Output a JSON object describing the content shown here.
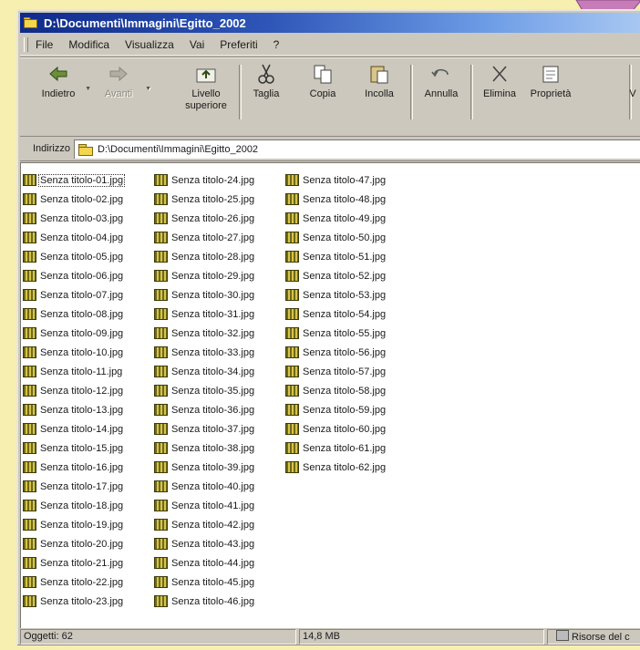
{
  "window": {
    "title": "D:\\Documenti\\Immagini\\Egitto_2002"
  },
  "menu": [
    "File",
    "Modifica",
    "Visualizza",
    "Vai",
    "Preferiti",
    "?"
  ],
  "toolbar": {
    "back": "Indietro",
    "forward": "Avanti",
    "up": "Livello superiore",
    "cut": "Taglia",
    "copy": "Copia",
    "paste": "Incolla",
    "undo": "Annulla",
    "delete": "Elimina",
    "properties": "Proprietà",
    "views_partial": "V"
  },
  "address": {
    "label": "Indirizzo",
    "path": "D:\\Documenti\\Immagini\\Egitto_2002"
  },
  "files": {
    "col1": [
      "Senza titolo-01.jpg",
      "Senza titolo-02.jpg",
      "Senza titolo-03.jpg",
      "Senza titolo-04.jpg",
      "Senza titolo-05.jpg",
      "Senza titolo-06.jpg",
      "Senza titolo-07.jpg",
      "Senza titolo-08.jpg",
      "Senza titolo-09.jpg",
      "Senza titolo-10.jpg",
      "Senza titolo-11.jpg",
      "Senza titolo-12.jpg",
      "Senza titolo-13.jpg",
      "Senza titolo-14.jpg",
      "Senza titolo-15.jpg",
      "Senza titolo-16.jpg",
      "Senza titolo-17.jpg",
      "Senza titolo-18.jpg",
      "Senza titolo-19.jpg",
      "Senza titolo-20.jpg",
      "Senza titolo-21.jpg",
      "Senza titolo-22.jpg",
      "Senza titolo-23.jpg"
    ],
    "col2": [
      "Senza titolo-24.jpg",
      "Senza titolo-25.jpg",
      "Senza titolo-26.jpg",
      "Senza titolo-27.jpg",
      "Senza titolo-28.jpg",
      "Senza titolo-29.jpg",
      "Senza titolo-30.jpg",
      "Senza titolo-31.jpg",
      "Senza titolo-32.jpg",
      "Senza titolo-33.jpg",
      "Senza titolo-34.jpg",
      "Senza titolo-35.jpg",
      "Senza titolo-36.jpg",
      "Senza titolo-37.jpg",
      "Senza titolo-38.jpg",
      "Senza titolo-39.jpg",
      "Senza titolo-40.jpg",
      "Senza titolo-41.jpg",
      "Senza titolo-42.jpg",
      "Senza titolo-43.jpg",
      "Senza titolo-44.jpg",
      "Senza titolo-45.jpg",
      "Senza titolo-46.jpg"
    ],
    "col3": [
      "Senza titolo-47.jpg",
      "Senza titolo-48.jpg",
      "Senza titolo-49.jpg",
      "Senza titolo-50.jpg",
      "Senza titolo-51.jpg",
      "Senza titolo-52.jpg",
      "Senza titolo-53.jpg",
      "Senza titolo-54.jpg",
      "Senza titolo-55.jpg",
      "Senza titolo-56.jpg",
      "Senza titolo-57.jpg",
      "Senza titolo-58.jpg",
      "Senza titolo-59.jpg",
      "Senza titolo-60.jpg",
      "Senza titolo-61.jpg",
      "Senza titolo-62.jpg"
    ]
  },
  "status": {
    "objects": "Oggetti: 62",
    "size": "14,8 MB",
    "location": "Risorse del c"
  },
  "colors": {
    "background": "#f6efb0",
    "title_start": "#0f2a8a",
    "title_end": "#a8c8f2",
    "pointer": "#c77bb8"
  }
}
